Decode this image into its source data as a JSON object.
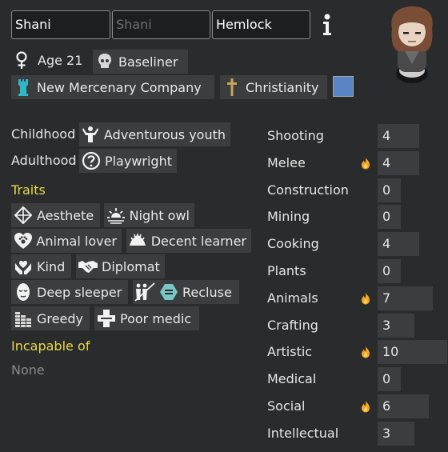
{
  "name": {
    "first": "Shani",
    "nick_placeholder": "Shani",
    "last": "Hemlock"
  },
  "info_icon": "info-icon",
  "bio": {
    "gender_icon": "female-icon",
    "age": "Age 21",
    "xenotype": "Baseliner",
    "faction": "New Mercenary Company",
    "ideology": "Christianity",
    "ideology_color": "#5b84c4"
  },
  "backstory": {
    "childhood_label": "Childhood",
    "childhood": "Adventurous youth",
    "adulthood_label": "Adulthood",
    "adulthood": "Playwright"
  },
  "traits_heading": "Traits",
  "traits": [
    {
      "label": "Aesthete",
      "icon": "aesthete-icon"
    },
    {
      "label": "Night owl",
      "icon": "night-owl-icon"
    },
    {
      "label": "Animal lover",
      "icon": "paw-heart-icon"
    },
    {
      "label": "Decent learner",
      "icon": "learner-icon"
    },
    {
      "label": "Kind",
      "icon": "heart-hands-icon"
    },
    {
      "label": "Diplomat",
      "icon": "handshake-icon"
    },
    {
      "label": "Deep sleeper",
      "icon": "sleep-mask-icon"
    },
    {
      "label": "Recluse",
      "icon": "recluse-icon"
    },
    {
      "label": "Greedy",
      "icon": "coins-icon"
    },
    {
      "label": "Poor medic",
      "icon": "medical-cross-icon"
    }
  ],
  "incapable": {
    "heading": "Incapable of",
    "value": "None"
  },
  "skills": [
    {
      "name": "Shooting",
      "level": "4",
      "passion": false,
      "fill": 0.2
    },
    {
      "name": "Melee",
      "level": "4",
      "passion": true,
      "fill": 0.2
    },
    {
      "name": "Construction",
      "level": "0",
      "passion": false,
      "fill": 0.0
    },
    {
      "name": "Mining",
      "level": "0",
      "passion": false,
      "fill": 0.0
    },
    {
      "name": "Cooking",
      "level": "4",
      "passion": false,
      "fill": 0.2
    },
    {
      "name": "Plants",
      "level": "0",
      "passion": false,
      "fill": 0.0
    },
    {
      "name": "Animals",
      "level": "7",
      "passion": true,
      "fill": 0.35
    },
    {
      "name": "Crafting",
      "level": "3",
      "passion": false,
      "fill": 0.15
    },
    {
      "name": "Artistic",
      "level": "10",
      "passion": true,
      "fill": 0.5
    },
    {
      "name": "Medical",
      "level": "0",
      "passion": false,
      "fill": 0.0
    },
    {
      "name": "Social",
      "level": "6",
      "passion": true,
      "fill": 0.3
    },
    {
      "name": "Intellectual",
      "level": "3",
      "passion": false,
      "fill": 0.15
    }
  ]
}
